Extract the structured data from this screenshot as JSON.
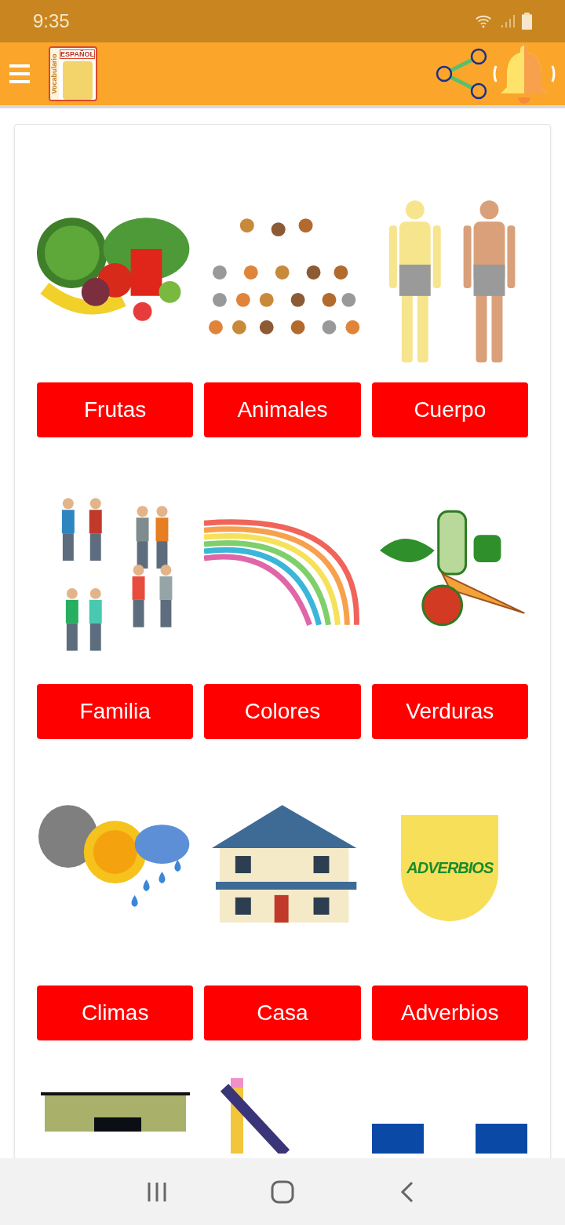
{
  "status_bar": {
    "time": "9:35"
  },
  "app_bar": {
    "logo": {
      "top_text": "ESPAÑOL",
      "side_text": "Vocabulario"
    }
  },
  "rows": [
    {
      "pictures": [
        {
          "kind": "fruits"
        },
        {
          "kind": "animals"
        },
        {
          "kind": "body"
        }
      ],
      "buttons": [
        "Frutas",
        "Animales",
        "Cuerpo"
      ]
    },
    {
      "pictures": [
        {
          "kind": "people"
        },
        {
          "kind": "rainbow"
        },
        {
          "kind": "vegetables"
        }
      ],
      "buttons": [
        "Familia",
        "Colores",
        "Verduras"
      ]
    },
    {
      "pictures": [
        {
          "kind": "weather"
        },
        {
          "kind": "house"
        },
        {
          "kind": "badge",
          "picture_text": "ADVERBIOS"
        }
      ],
      "buttons": [
        "Climas",
        "Casa",
        "Adverbios"
      ]
    },
    {
      "pictures": [
        {
          "kind": "kitchen"
        },
        {
          "kind": "pencil"
        },
        {
          "kind": "blocks"
        }
      ]
    }
  ]
}
